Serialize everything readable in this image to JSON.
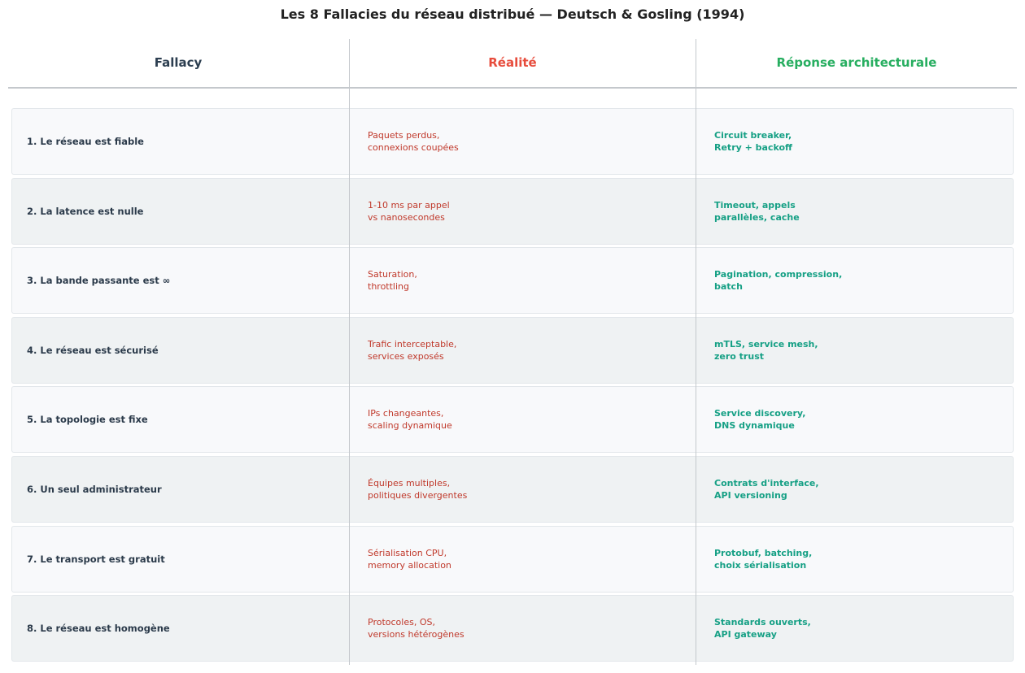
{
  "title": "Les 8 Fallacies du réseau distribué — Deutsch & Gosling (1994)",
  "colors": {
    "fallacy": "#2c3e50",
    "reality": "#e74c3c",
    "response": "#27ae60",
    "reality_text": "#c0392b",
    "response_text": "#16a085"
  },
  "headers": {
    "fallacy": "Fallacy",
    "reality": "Réalité",
    "response": "Réponse architecturale"
  },
  "rows": [
    {
      "fallacy": "1. Le réseau est fiable",
      "reality": "Paquets perdus,\nconnexions coupées",
      "response": "Circuit breaker,\nRetry + backoff"
    },
    {
      "fallacy": "2. La latence est nulle",
      "reality": "1-10 ms par appel\nvs nanosecondes",
      "response": "Timeout, appels\nparallèles, cache"
    },
    {
      "fallacy": "3. La bande passante est ∞",
      "reality": "Saturation,\nthrottling",
      "response": "Pagination, compression,\nbatch"
    },
    {
      "fallacy": "4. Le réseau est sécurisé",
      "reality": "Trafic interceptable,\nservices exposés",
      "response": "mTLS, service mesh,\nzero trust"
    },
    {
      "fallacy": "5. La topologie est fixe",
      "reality": "IPs changeantes,\nscaling dynamique",
      "response": "Service discovery,\nDNS dynamique"
    },
    {
      "fallacy": "6. Un seul administrateur",
      "reality": "Équipes multiples,\npolitiques divergentes",
      "response": "Contrats d'interface,\nAPI versioning"
    },
    {
      "fallacy": "7. Le transport est gratuit",
      "reality": "Sérialisation CPU,\nmemory allocation",
      "response": "Protobuf, batching,\nchoix sérialisation"
    },
    {
      "fallacy": "8. Le réseau est homogène",
      "reality": "Protocoles, OS,\nversions hétérogènes",
      "response": "Standards ouverts,\nAPI gateway"
    }
  ]
}
